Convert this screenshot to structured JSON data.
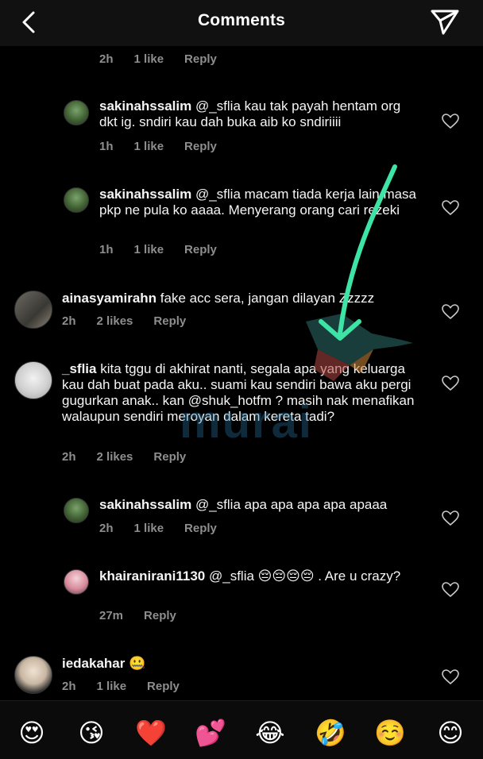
{
  "header": {
    "title": "Comments"
  },
  "top_meta": {
    "time": "2h",
    "likes": "1 like",
    "reply": "Reply"
  },
  "comments": [
    {
      "user": "sakinahssalim",
      "text": " @_sflia kau tak payah hentam org dkt ig. sndiri kau dah buka aib ko sndiriiii",
      "time": "1h",
      "likes": "1 like",
      "reply": "Reply"
    },
    {
      "user": "sakinahssalim",
      "text": " @_sflia macam tiada kerja lain masa pkp ne pula ko aaaa. Menyerang orang cari rezeki",
      "time": "1h",
      "likes": "1 like",
      "reply": "Reply"
    },
    {
      "user": "ainasyamirahn",
      "text": " fake acc sera, jangan dilayan Zzzzz",
      "time": "2h",
      "likes": "2 likes",
      "reply": "Reply"
    },
    {
      "user": "_sflia",
      "text": " kita tggu di akhirat nanti, segala apa yang keluarga kau dah buat pada aku.. suami kau sendiri bawa aku pergi gugurkan anak.. kan @shuk_hotfm ? masih nak menafikan walaupun sendiri meroyan dalam kereta tadi?",
      "time": "2h",
      "likes": "2 likes",
      "reply": "Reply"
    },
    {
      "user": "sakinahssalim",
      "text": " @_sflia apa apa apa apa apaaa",
      "time": "2h",
      "likes": "1 like",
      "reply": "Reply"
    },
    {
      "user": "khairanirani1130",
      "text": " @_sflia 😔😔😔😔 . Are u crazy?",
      "time": "27m",
      "likes": "",
      "reply": "Reply"
    },
    {
      "user": "iedakahar",
      "text": " 🤐",
      "time": "2h",
      "likes": "1 like",
      "reply": "Reply"
    }
  ],
  "emojis": [
    "😍",
    "😘",
    "❤️",
    "💕",
    "😂",
    "🤣",
    "☺️",
    "😊"
  ],
  "watermark": "murai",
  "colors": {
    "background": "#000000",
    "header": "#111111",
    "meta": "#8e8e8e",
    "arrow": "#3ee3a6"
  }
}
